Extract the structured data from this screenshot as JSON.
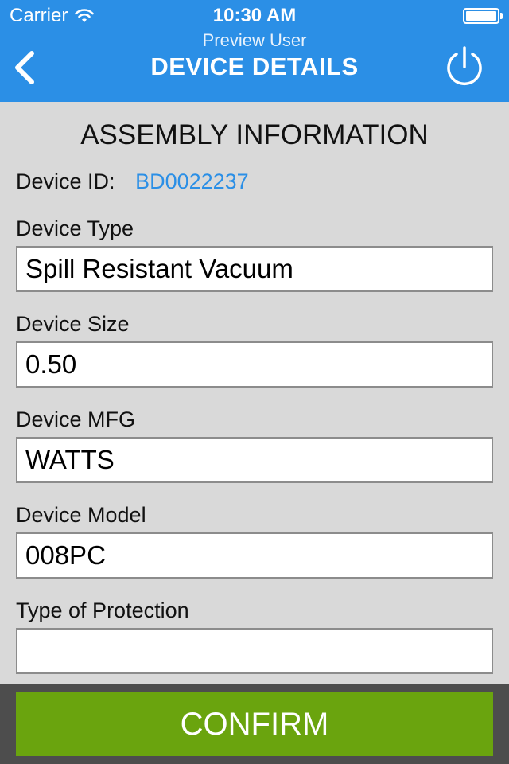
{
  "status_bar": {
    "carrier": "Carrier",
    "time": "10:30 AM"
  },
  "nav": {
    "subtitle": "Preview User",
    "title": "DEVICE DETAILS",
    "back_icon": "chevron-left-icon",
    "power_icon": "power-icon"
  },
  "section": {
    "title": "ASSEMBLY INFORMATION"
  },
  "device_id": {
    "label": "Device ID:",
    "value": "BD0022237"
  },
  "fields": [
    {
      "label": "Device Type",
      "value": "Spill Resistant Vacuum"
    },
    {
      "label": "Device Size",
      "value": "0.50"
    },
    {
      "label": "Device MFG",
      "value": "WATTS"
    },
    {
      "label": "Device Model",
      "value": "008PC"
    },
    {
      "label": "Type of Protection",
      "value": ""
    }
  ],
  "footer": {
    "confirm_label": "CONFIRM"
  },
  "colors": {
    "header_bg": "#2b8fe6",
    "link_blue": "#2b8fe6",
    "confirm_green": "#6aa40e",
    "footer_bg": "#4d4d4d",
    "page_bg": "#d9d9d9"
  }
}
